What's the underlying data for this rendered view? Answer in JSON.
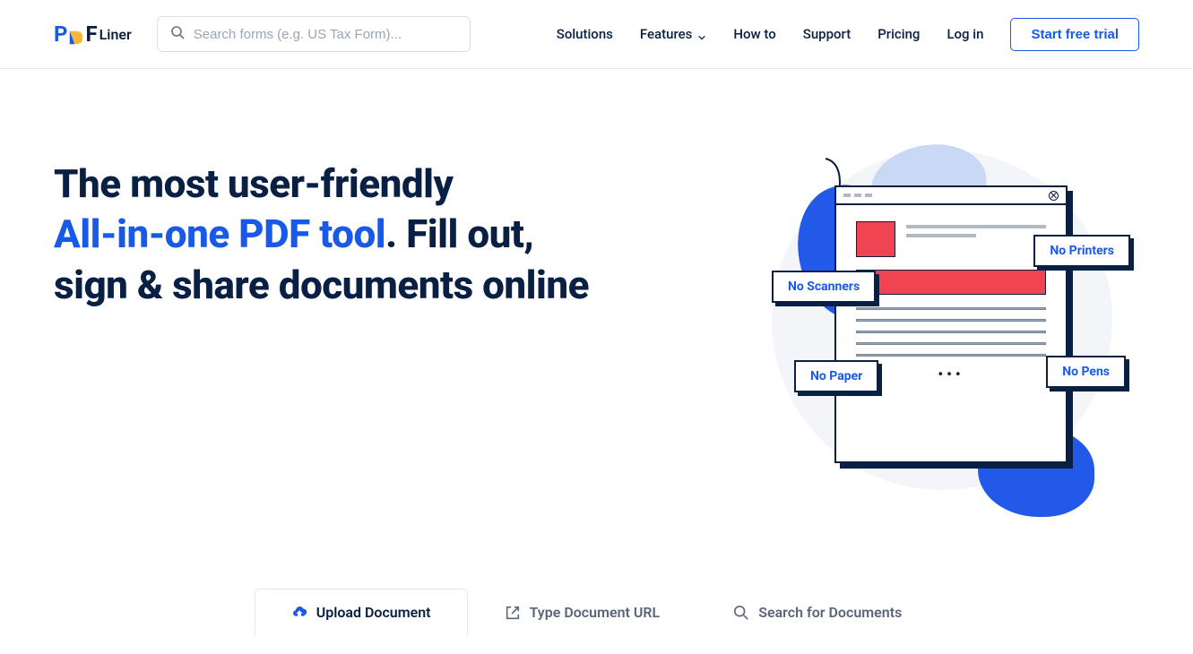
{
  "logo": {
    "part1": "P",
    "part2": "F",
    "suffix": "Liner"
  },
  "search": {
    "placeholder": "Search forms (e.g. US Tax Form)..."
  },
  "nav": {
    "solutions": "Solutions",
    "features": "Features",
    "howto": "How to",
    "support": "Support",
    "pricing": "Pricing",
    "login": "Log in",
    "cta": "Start free trial"
  },
  "hero": {
    "line1": "The most user-friendly",
    "accent": "All-in-one PDF tool",
    "line2_after": ". Fill out,",
    "line3": "sign & share documents online"
  },
  "badges": {
    "scanners": "No Scanners",
    "printers": "No Printers",
    "paper": "No Paper",
    "pens": "No Pens"
  },
  "tabs": {
    "upload": "Upload Document",
    "url": "Type Document URL",
    "search": "Search for Documents"
  }
}
